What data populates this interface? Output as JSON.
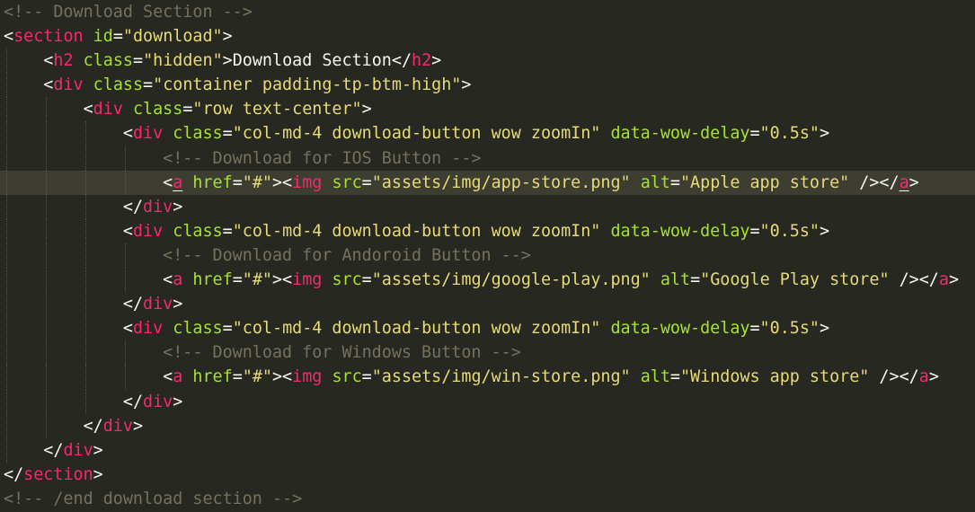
{
  "editor": {
    "theme": {
      "background": "#272822",
      "active_line": "#3e3d32",
      "comment": "#75715e",
      "tag": "#f92672",
      "attribute": "#a6e22e",
      "string": "#e6db74",
      "plain": "#f8f8f2"
    },
    "active_line_index": 7,
    "lines": [
      {
        "indent": 0,
        "tokens": [
          {
            "t": "c",
            "v": "<!-- Download Section -->"
          }
        ]
      },
      {
        "indent": 0,
        "tokens": [
          {
            "t": "p",
            "v": "<"
          },
          {
            "t": "t",
            "v": "section"
          },
          {
            "t": "p",
            "v": " "
          },
          {
            "t": "a",
            "v": "id"
          },
          {
            "t": "p",
            "v": "="
          },
          {
            "t": "s",
            "v": "\"download\""
          },
          {
            "t": "p",
            "v": ">"
          }
        ]
      },
      {
        "indent": 1,
        "tokens": [
          {
            "t": "p",
            "v": "<"
          },
          {
            "t": "t",
            "v": "h2"
          },
          {
            "t": "p",
            "v": " "
          },
          {
            "t": "a",
            "v": "class"
          },
          {
            "t": "p",
            "v": "="
          },
          {
            "t": "s",
            "v": "\"hidden\""
          },
          {
            "t": "p",
            "v": ">Download Section</"
          },
          {
            "t": "t",
            "v": "h2"
          },
          {
            "t": "p",
            "v": ">"
          }
        ]
      },
      {
        "indent": 1,
        "tokens": [
          {
            "t": "p",
            "v": "<"
          },
          {
            "t": "t",
            "v": "div"
          },
          {
            "t": "p",
            "v": " "
          },
          {
            "t": "a",
            "v": "class"
          },
          {
            "t": "p",
            "v": "="
          },
          {
            "t": "s",
            "v": "\"container padding-tp-btm-high\""
          },
          {
            "t": "p",
            "v": ">"
          }
        ]
      },
      {
        "indent": 2,
        "tokens": [
          {
            "t": "p",
            "v": "<"
          },
          {
            "t": "t",
            "v": "div"
          },
          {
            "t": "p",
            "v": " "
          },
          {
            "t": "a",
            "v": "class"
          },
          {
            "t": "p",
            "v": "="
          },
          {
            "t": "s",
            "v": "\"row text-center\""
          },
          {
            "t": "p",
            "v": ">"
          }
        ]
      },
      {
        "indent": 3,
        "tokens": [
          {
            "t": "p",
            "v": "<"
          },
          {
            "t": "t",
            "v": "div"
          },
          {
            "t": "p",
            "v": " "
          },
          {
            "t": "a",
            "v": "class"
          },
          {
            "t": "p",
            "v": "="
          },
          {
            "t": "s",
            "v": "\"col-md-4 download-button wow zoomIn\""
          },
          {
            "t": "p",
            "v": " "
          },
          {
            "t": "a",
            "v": "data-wow-delay"
          },
          {
            "t": "p",
            "v": "="
          },
          {
            "t": "s",
            "v": "\"0.5s\""
          },
          {
            "t": "p",
            "v": ">"
          }
        ]
      },
      {
        "indent": 4,
        "tokens": [
          {
            "t": "c",
            "v": "<!-- Download for IOS Button -->"
          }
        ]
      },
      {
        "indent": 4,
        "tokens": [
          {
            "t": "p",
            "v": "<"
          },
          {
            "t": "t",
            "v": "a",
            "m": true
          },
          {
            "t": "p",
            "v": " "
          },
          {
            "t": "a",
            "v": "href"
          },
          {
            "t": "p",
            "v": "="
          },
          {
            "t": "s",
            "v": "\"#\""
          },
          {
            "t": "p",
            "v": "><"
          },
          {
            "t": "t",
            "v": "img"
          },
          {
            "t": "p",
            "v": " "
          },
          {
            "t": "a",
            "v": "src"
          },
          {
            "t": "p",
            "v": "="
          },
          {
            "t": "s",
            "v": "\"assets/img/app-store.png\""
          },
          {
            "t": "p",
            "v": " "
          },
          {
            "t": "a",
            "v": "alt"
          },
          {
            "t": "p",
            "v": "="
          },
          {
            "t": "s",
            "v": "\"Apple app store\""
          },
          {
            "t": "p",
            "v": " /></"
          },
          {
            "t": "t",
            "v": "a",
            "m": true
          },
          {
            "t": "p",
            "v": ">"
          }
        ]
      },
      {
        "indent": 3,
        "tokens": [
          {
            "t": "p",
            "v": "</"
          },
          {
            "t": "t",
            "v": "div"
          },
          {
            "t": "p",
            "v": ">"
          }
        ]
      },
      {
        "indent": 3,
        "tokens": [
          {
            "t": "p",
            "v": "<"
          },
          {
            "t": "t",
            "v": "div"
          },
          {
            "t": "p",
            "v": " "
          },
          {
            "t": "a",
            "v": "class"
          },
          {
            "t": "p",
            "v": "="
          },
          {
            "t": "s",
            "v": "\"col-md-4 download-button wow zoomIn\""
          },
          {
            "t": "p",
            "v": " "
          },
          {
            "t": "a",
            "v": "data-wow-delay"
          },
          {
            "t": "p",
            "v": "="
          },
          {
            "t": "s",
            "v": "\"0.5s\""
          },
          {
            "t": "p",
            "v": ">"
          }
        ]
      },
      {
        "indent": 4,
        "tokens": [
          {
            "t": "c",
            "v": "<!-- Download for Andoroid Button -->"
          }
        ]
      },
      {
        "indent": 4,
        "tokens": [
          {
            "t": "p",
            "v": "<"
          },
          {
            "t": "t",
            "v": "a"
          },
          {
            "t": "p",
            "v": " "
          },
          {
            "t": "a",
            "v": "href"
          },
          {
            "t": "p",
            "v": "="
          },
          {
            "t": "s",
            "v": "\"#\""
          },
          {
            "t": "p",
            "v": "><"
          },
          {
            "t": "t",
            "v": "img"
          },
          {
            "t": "p",
            "v": " "
          },
          {
            "t": "a",
            "v": "src"
          },
          {
            "t": "p",
            "v": "="
          },
          {
            "t": "s",
            "v": "\"assets/img/google-play.png\""
          },
          {
            "t": "p",
            "v": " "
          },
          {
            "t": "a",
            "v": "alt"
          },
          {
            "t": "p",
            "v": "="
          },
          {
            "t": "s",
            "v": "\"Google Play store\""
          },
          {
            "t": "p",
            "v": " /></"
          },
          {
            "t": "t",
            "v": "a"
          },
          {
            "t": "p",
            "v": ">"
          }
        ]
      },
      {
        "indent": 3,
        "tokens": [
          {
            "t": "p",
            "v": "</"
          },
          {
            "t": "t",
            "v": "div"
          },
          {
            "t": "p",
            "v": ">"
          }
        ]
      },
      {
        "indent": 3,
        "tokens": [
          {
            "t": "p",
            "v": "<"
          },
          {
            "t": "t",
            "v": "div"
          },
          {
            "t": "p",
            "v": " "
          },
          {
            "t": "a",
            "v": "class"
          },
          {
            "t": "p",
            "v": "="
          },
          {
            "t": "s",
            "v": "\"col-md-4 download-button wow zoomIn\""
          },
          {
            "t": "p",
            "v": " "
          },
          {
            "t": "a",
            "v": "data-wow-delay"
          },
          {
            "t": "p",
            "v": "="
          },
          {
            "t": "s",
            "v": "\"0.5s\""
          },
          {
            "t": "p",
            "v": ">"
          }
        ]
      },
      {
        "indent": 4,
        "tokens": [
          {
            "t": "c",
            "v": "<!-- Download for Windows Button -->"
          }
        ]
      },
      {
        "indent": 4,
        "tokens": [
          {
            "t": "p",
            "v": "<"
          },
          {
            "t": "t",
            "v": "a"
          },
          {
            "t": "p",
            "v": " "
          },
          {
            "t": "a",
            "v": "href"
          },
          {
            "t": "p",
            "v": "="
          },
          {
            "t": "s",
            "v": "\"#\""
          },
          {
            "t": "p",
            "v": "><"
          },
          {
            "t": "t",
            "v": "img"
          },
          {
            "t": "p",
            "v": " "
          },
          {
            "t": "a",
            "v": "src"
          },
          {
            "t": "p",
            "v": "="
          },
          {
            "t": "s",
            "v": "\"assets/img/win-store.png\""
          },
          {
            "t": "p",
            "v": " "
          },
          {
            "t": "a",
            "v": "alt"
          },
          {
            "t": "p",
            "v": "="
          },
          {
            "t": "s",
            "v": "\"Windows app store\""
          },
          {
            "t": "p",
            "v": " /></"
          },
          {
            "t": "t",
            "v": "a"
          },
          {
            "t": "p",
            "v": ">"
          }
        ]
      },
      {
        "indent": 3,
        "tokens": [
          {
            "t": "p",
            "v": "</"
          },
          {
            "t": "t",
            "v": "div"
          },
          {
            "t": "p",
            "v": ">"
          }
        ]
      },
      {
        "indent": 2,
        "tokens": [
          {
            "t": "p",
            "v": "</"
          },
          {
            "t": "t",
            "v": "div"
          },
          {
            "t": "p",
            "v": ">"
          }
        ]
      },
      {
        "indent": 1,
        "tokens": [
          {
            "t": "p",
            "v": "</"
          },
          {
            "t": "t",
            "v": "div"
          },
          {
            "t": "p",
            "v": ">"
          }
        ]
      },
      {
        "indent": 0,
        "tokens": [
          {
            "t": "p",
            "v": "</"
          },
          {
            "t": "t",
            "v": "section"
          },
          {
            "t": "p",
            "v": ">"
          }
        ]
      },
      {
        "indent": 0,
        "tokens": [
          {
            "t": "c",
            "v": "<!-- /end download section -->"
          }
        ]
      }
    ]
  }
}
